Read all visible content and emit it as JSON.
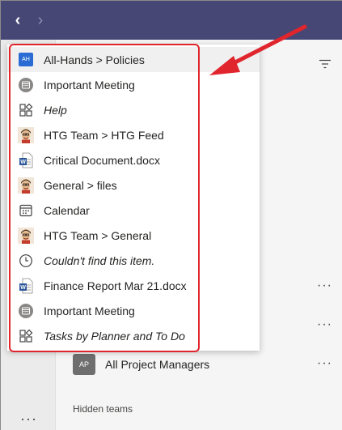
{
  "nav": {
    "back_glyph": "‹",
    "forward_glyph": "›"
  },
  "rail": {
    "more_glyph": "···"
  },
  "list": {
    "more_glyph": "···",
    "team_avatar_text": "AP",
    "team_name": "All Project Managers",
    "hidden_teams_label": "Hidden teams"
  },
  "dropdown": {
    "items": [
      {
        "label": "All-Hands > Policies",
        "icon": "team-avatar-icon",
        "icon_text": "AH",
        "italic": false,
        "active": true
      },
      {
        "label": "Important Meeting",
        "icon": "meeting-icon",
        "italic": false
      },
      {
        "label": "Help",
        "icon": "app-icon",
        "italic": true
      },
      {
        "label": "HTG Team > HTG Feed",
        "icon": "htg-avatar-icon",
        "italic": false
      },
      {
        "label": "Critical Document.docx",
        "icon": "word-file-icon",
        "italic": false
      },
      {
        "label": "General > files",
        "icon": "htg-avatar-icon",
        "italic": false
      },
      {
        "label": "Calendar",
        "icon": "calendar-icon",
        "italic": false
      },
      {
        "label": "HTG Team > General",
        "icon": "htg-avatar-icon",
        "italic": false
      },
      {
        "label": "Couldn't find this item.",
        "icon": "clock-icon",
        "italic": true
      },
      {
        "label": "Finance Report Mar 21.docx",
        "icon": "word-file-icon",
        "italic": false
      },
      {
        "label": "Important Meeting",
        "icon": "meeting-icon",
        "italic": false
      },
      {
        "label": "Tasks by Planner and To Do",
        "icon": "app-icon",
        "italic": true
      }
    ]
  },
  "colors": {
    "topbar": "#464775",
    "highlight": "#e0252d",
    "word_blue": "#2b579a",
    "team_blue": "#2b6cd4"
  }
}
